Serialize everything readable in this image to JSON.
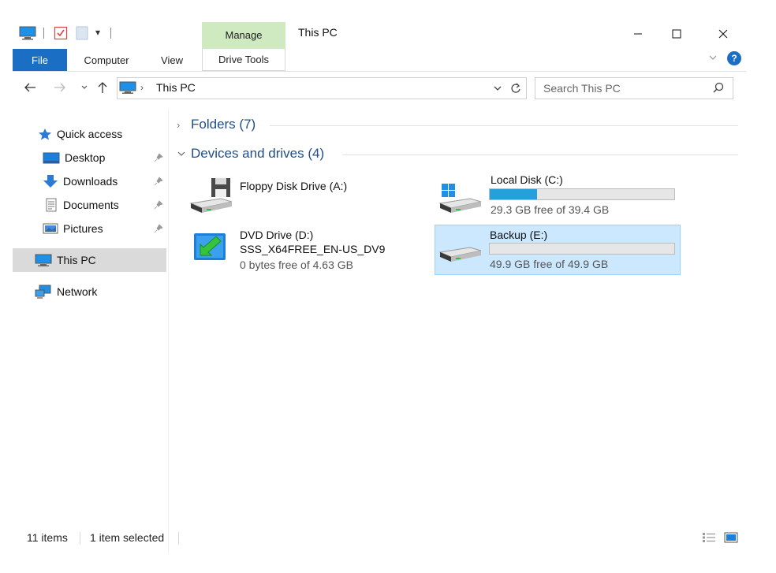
{
  "window": {
    "title": "This PC",
    "manage_tab": "Manage",
    "controls": {
      "minimize": "—",
      "maximize": "☐",
      "close": "✕"
    }
  },
  "ribbon": {
    "tabs": [
      "File",
      "Computer",
      "View",
      "Drive Tools"
    ],
    "help": "?"
  },
  "address": {
    "location_label": "This PC",
    "search_placeholder": "Search This PC"
  },
  "nav": {
    "items": [
      {
        "label": "Quick access",
        "icon": "star-icon"
      },
      {
        "label": "Desktop",
        "icon": "desktop-folder-icon",
        "pinned": true
      },
      {
        "label": "Downloads",
        "icon": "downloads-icon",
        "pinned": true
      },
      {
        "label": "Documents",
        "icon": "documents-icon",
        "pinned": true
      },
      {
        "label": "Pictures",
        "icon": "pictures-icon",
        "pinned": true
      },
      {
        "label": "This PC",
        "icon": "computer-icon",
        "selected": true
      },
      {
        "label": "Network",
        "icon": "network-icon"
      }
    ]
  },
  "content": {
    "folders_group": "Folders (7)",
    "drives_group": "Devices and drives (4)",
    "drives": [
      {
        "name": "Floppy Disk Drive (A:)",
        "icon": "floppy-drive-icon"
      },
      {
        "name": "Local Disk (C:)",
        "free_text": "29.3 GB free of 39.4 GB",
        "used_fraction": 0.256,
        "icon": "windows-drive-icon"
      },
      {
        "name": "DVD Drive (D:)",
        "label": "SSS_X64FREE_EN-US_DV9",
        "free_text": "0 bytes free of 4.63 GB",
        "icon": "dvd-setup-icon"
      },
      {
        "name": "Backup (E:)",
        "free_text": "49.9 GB free of 49.9 GB",
        "used_fraction": 0.0,
        "icon": "hard-drive-icon",
        "selected": true
      }
    ]
  },
  "status": {
    "items": "11 items",
    "selected": "1 item selected"
  },
  "colors": {
    "accent": "#1a6fc4",
    "manage": "#cfeac0",
    "usage_bar": "#26a0da",
    "selection": "#cce8ff"
  }
}
